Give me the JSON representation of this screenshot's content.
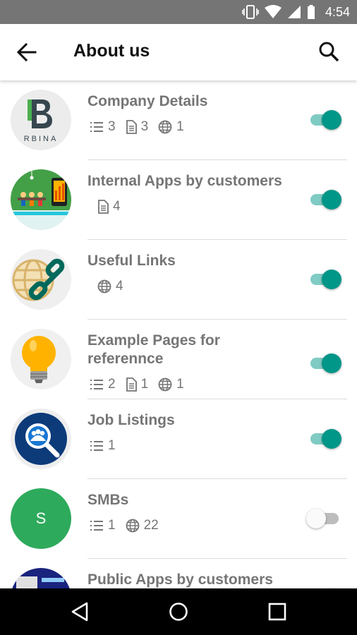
{
  "status_bar": {
    "time": "4:54",
    "icons": [
      "vibrate-icon",
      "wifi-icon",
      "signal-icon",
      "battery-icon"
    ]
  },
  "app_bar": {
    "title": "About us",
    "back_icon": "arrow-back-icon",
    "search_icon": "search-icon"
  },
  "items": [
    {
      "title": "Company Details",
      "avatar": "orbina-logo",
      "avatar_text": "RBINA",
      "stats": {
        "lists": "3",
        "pages": "3",
        "links": "1"
      },
      "enabled": true
    },
    {
      "title": "Internal Apps by customers",
      "avatar": "office-illustration",
      "stats": {
        "pages": "4"
      },
      "enabled": true
    },
    {
      "title": "Useful Links",
      "avatar": "globe-chain-icon",
      "stats": {
        "links": "4"
      },
      "enabled": true
    },
    {
      "title": "Example Pages for referennce",
      "avatar": "lightbulb-icon",
      "stats": {
        "lists": "2",
        "pages": "1",
        "links": "1"
      },
      "enabled": true
    },
    {
      "title": "Job Listings",
      "avatar": "people-search-icon",
      "stats": {
        "lists": "1"
      },
      "enabled": true
    },
    {
      "title": "SMBs",
      "avatar": "letter-avatar",
      "avatar_letter": "S",
      "stats": {
        "lists": "1",
        "links": "22"
      },
      "enabled": false
    },
    {
      "title": "Public Apps by customers",
      "avatar": "app-screenshot",
      "enabled": true
    }
  ],
  "colors": {
    "accent": "#009688",
    "accent_track": "#80cbc4",
    "status_bar": "#757575",
    "text_secondary": "#757575",
    "smb_avatar": "#2eaa5c"
  },
  "nav_bar": {
    "icons": [
      "nav-back-icon",
      "nav-home-icon",
      "nav-recents-icon"
    ]
  }
}
